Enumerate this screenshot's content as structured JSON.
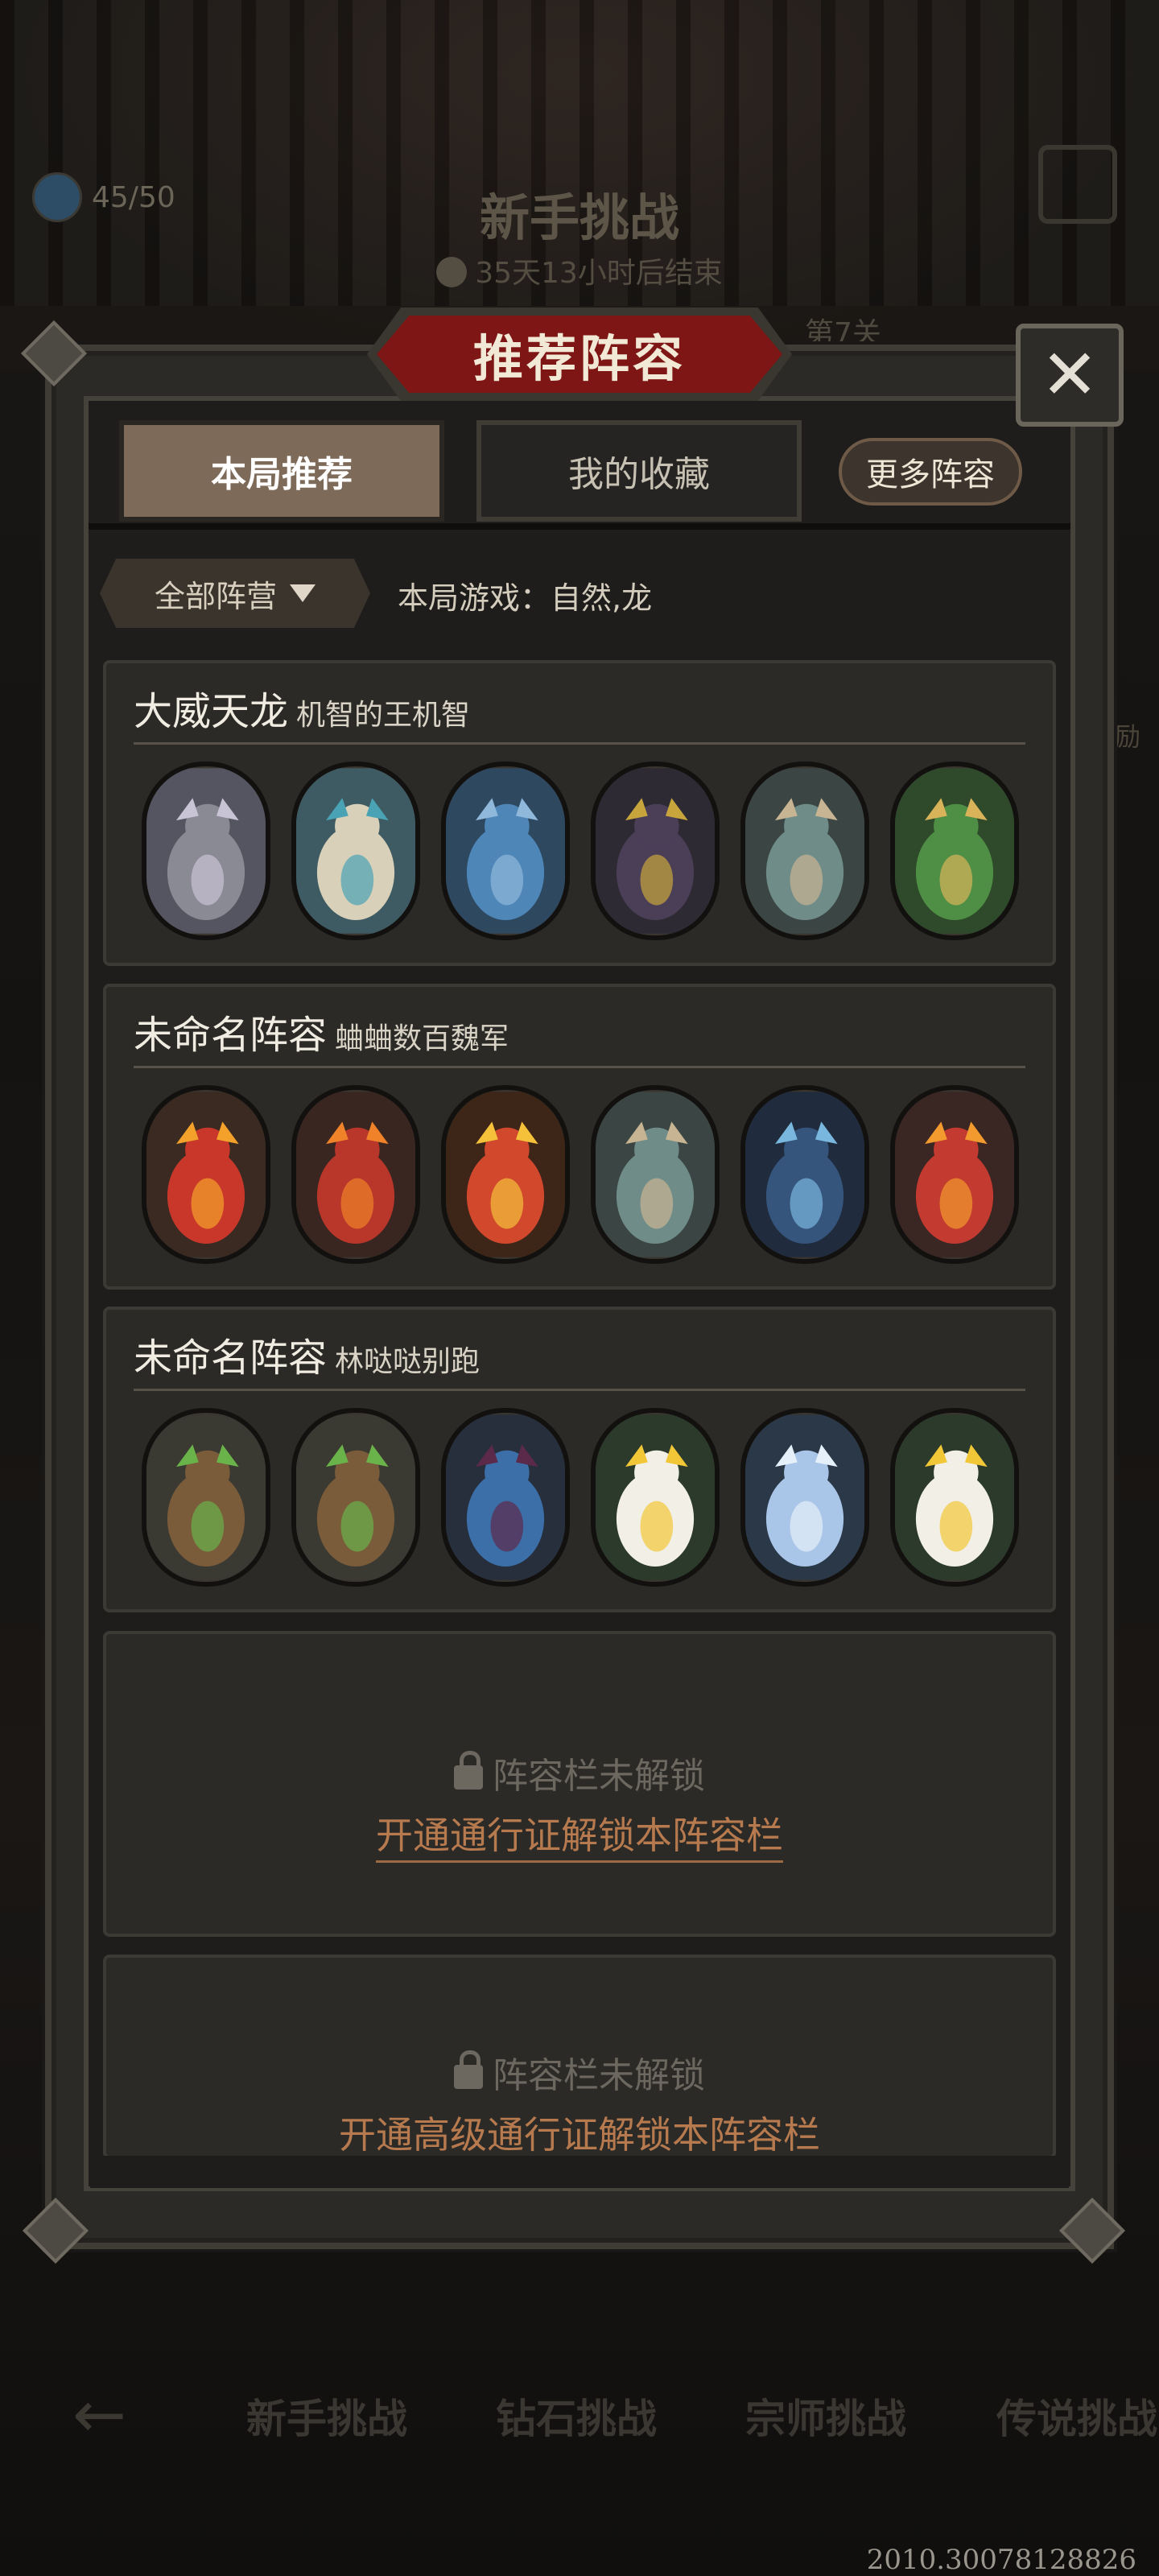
{
  "background": {
    "stamina": "45/50",
    "event_title": "新手挑战",
    "event_timer": "35天13小时后结束",
    "level": "第7关",
    "side_text": "励",
    "bottom_tabs": [
      "新手挑战",
      "钻石挑战",
      "宗师挑战",
      "传说挑战"
    ],
    "coordinates": "2010.30078128826"
  },
  "modal": {
    "title": "推荐阵容",
    "close_icon": "close-icon",
    "tabs": [
      {
        "label": "本局推荐",
        "active": true
      },
      {
        "label": "我的收藏",
        "active": false
      }
    ],
    "more_button": "更多阵容",
    "filter_label": "全部阵营",
    "game_info": "本局游戏：自然,龙"
  },
  "lineups": [
    {
      "name": "大威天龙",
      "author": "机智的王机智",
      "units": [
        "grey-horned-dragon",
        "white-eastern-dragon",
        "blue-baby-dragon",
        "dark-purple-dragon",
        "grey-winged-demon",
        "green-horned-dragon"
      ]
    },
    {
      "name": "未命名阵容",
      "author": "蛐蛐数百魏军",
      "units": [
        "red-fire-whelp",
        "red-fire-drake",
        "fire-dragon",
        "grey-winged-demon",
        "blue-storm-dragon",
        "red-fire-dragon"
      ]
    },
    {
      "name": "未命名阵容",
      "author": "林哒哒别跑",
      "units": [
        "sapling-tree",
        "sapling-tree",
        "blue-elf-sorceress",
        "singing-flower",
        "ice-maiden",
        "singing-flower"
      ]
    }
  ],
  "locked_slots": [
    {
      "status": "阵容栏未解锁",
      "action": "开通通行证解锁本阵容栏"
    },
    {
      "status": "阵容栏未解锁",
      "action": "开通高级通行证解锁本阵容栏"
    }
  ],
  "colors": {
    "title_banner": "#7d1614",
    "active_tab": "#7e6a58",
    "unlock_link": "#b67a4e",
    "panel_bg": "#2b2a27"
  }
}
